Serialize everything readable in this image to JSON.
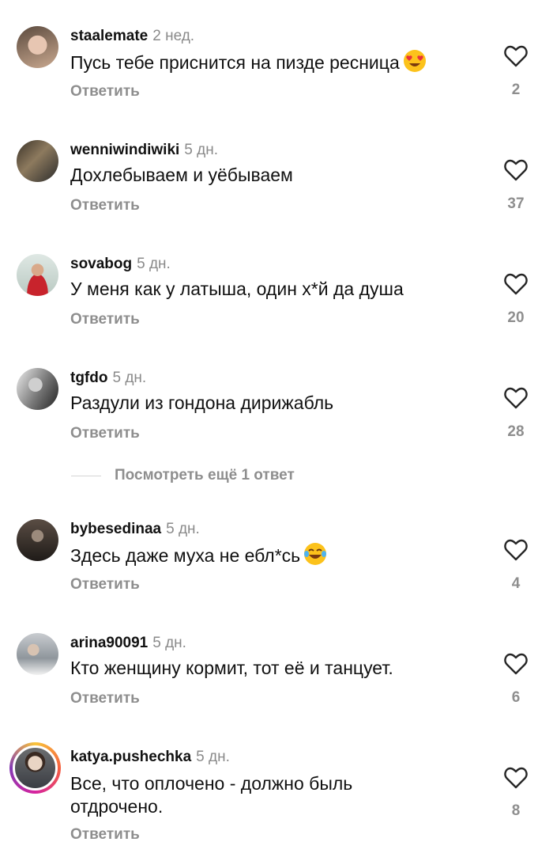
{
  "comments": [
    {
      "username": "staalemate",
      "time": "2 нед.",
      "text": "Пусь тебе приснится на пизде ресница",
      "emoji": "heart-eyes",
      "reply_label": "Ответить",
      "likes": "2"
    },
    {
      "username": "wenniwindiwiki",
      "time": "5 дн.",
      "text": "Дохлебываем и уёбываем",
      "reply_label": "Ответить",
      "likes": "37"
    },
    {
      "username": "sovabog",
      "time": "5 дн.",
      "text": "У меня как у латыша, один х*й да душа",
      "reply_label": "Ответить",
      "likes": "20"
    },
    {
      "username": "tgfdo",
      "time": "5 дн.",
      "text": "Раздули из гондона дирижабль",
      "reply_label": "Ответить",
      "likes": "28"
    },
    {
      "username": "bybesedinaa",
      "time": "5 дн.",
      "text": "Здесь даже муха не ебл*сь",
      "emoji": "tears-of-joy",
      "reply_label": "Ответить",
      "likes": "4"
    },
    {
      "username": "arina90091",
      "time": "5 дн.",
      "text": "Кто женщину кормит, тот её и танцует.",
      "reply_label": "Ответить",
      "likes": "6"
    },
    {
      "username": "katya.pushechka",
      "time": "5 дн.",
      "text_line1": "Все, что оплочено - должно быль",
      "text_line2": "отдрочено.",
      "reply_label": "Ответить",
      "likes": "8",
      "story_ring": true
    }
  ],
  "view_more_replies": "Посмотреть ещё 1 ответ",
  "colors": {
    "secondary_text": "#8e8e8e",
    "primary_text": "#111111",
    "background": "#ffffff"
  }
}
